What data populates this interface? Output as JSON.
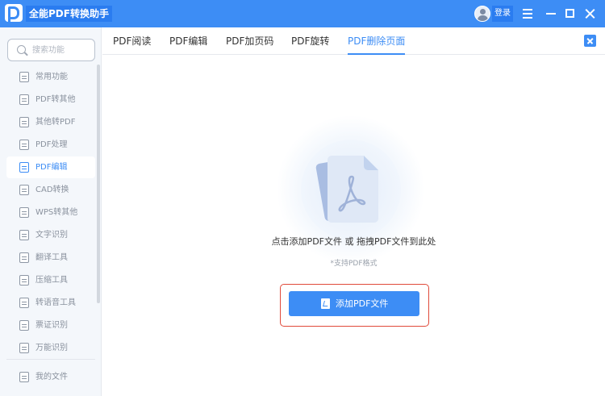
{
  "app": {
    "title": "全能PDF转换助手",
    "login_label": "登录"
  },
  "sidebar": {
    "search_placeholder": "搜索功能",
    "items": [
      {
        "label": "常用功能",
        "icon": "star-doc-icon"
      },
      {
        "label": "PDF转其他",
        "icon": "pdf-export-icon"
      },
      {
        "label": "其他转PDF",
        "icon": "pdf-import-icon"
      },
      {
        "label": "PDF处理",
        "icon": "pdf-process-icon"
      },
      {
        "label": "PDF编辑",
        "icon": "pdf-edit-icon",
        "active": true
      },
      {
        "label": "CAD转换",
        "icon": "cad-icon"
      },
      {
        "label": "WPS转其他",
        "icon": "wps-icon"
      },
      {
        "label": "文字识别",
        "icon": "ocr-icon"
      },
      {
        "label": "翻译工具",
        "icon": "translate-icon"
      },
      {
        "label": "压缩工具",
        "icon": "compress-icon"
      },
      {
        "label": "转语音工具",
        "icon": "speech-icon"
      },
      {
        "label": "票证识别",
        "icon": "ticket-icon"
      },
      {
        "label": "万能识别",
        "icon": "scan-icon"
      }
    ],
    "my_files_label": "我的文件"
  },
  "tabs": [
    {
      "label": "PDF阅读"
    },
    {
      "label": "PDF编辑"
    },
    {
      "label": "PDF加页码"
    },
    {
      "label": "PDF旋转"
    },
    {
      "label": "PDF删除页面",
      "active": true
    }
  ],
  "main": {
    "drop_hint": "点击添加PDF文件 或 拖拽PDF文件到此处",
    "format_hint": "*支持PDF格式",
    "add_button_label": "添加PDF文件"
  },
  "colors": {
    "accent": "#3d8df5",
    "highlight_border": "#e04a3a"
  }
}
